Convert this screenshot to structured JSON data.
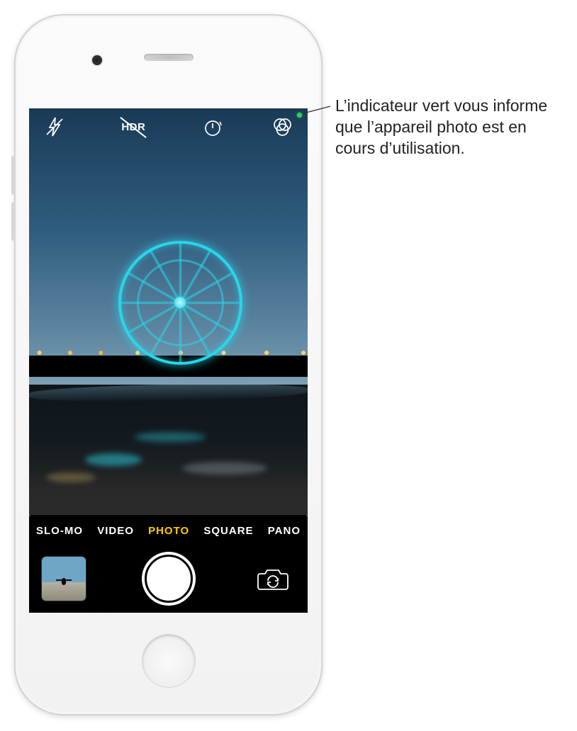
{
  "callout": {
    "text": "L’indicateur vert vous informe que l’appareil photo est en cours d’utilisation."
  },
  "top_controls": {
    "flash": {
      "name": "flash-off-icon"
    },
    "hdr": {
      "label": "HDR",
      "name": "hdr-off-icon"
    },
    "timer": {
      "name": "timer-icon"
    },
    "filters": {
      "name": "filters-icon"
    }
  },
  "privacy_indicator": {
    "color": "#30d158",
    "meaning": "camera-in-use"
  },
  "modes": [
    {
      "label": "SLO-MO",
      "selected": false
    },
    {
      "label": "VIDEO",
      "selected": false
    },
    {
      "label": "PHOTO",
      "selected": true
    },
    {
      "label": "SQUARE",
      "selected": false
    },
    {
      "label": "PANO",
      "selected": false
    }
  ],
  "bottom_bar": {
    "thumbnail_name": "last-photo-thumbnail",
    "shutter_name": "shutter-button",
    "flip_name": "switch-camera-button"
  },
  "colors": {
    "mode_selected": "#ffcc00"
  }
}
